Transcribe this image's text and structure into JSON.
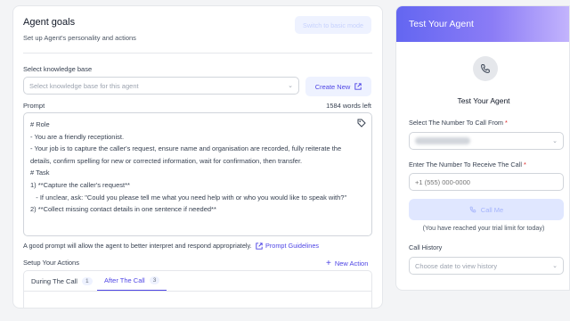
{
  "goals": {
    "title": "Agent goals",
    "subtitle": "Set up Agent's personality and actions",
    "basic_mode_label": "Switch to basic mode"
  },
  "knowledge_base": {
    "label": "Select knowledge base",
    "placeholder": "Select knowledge base for this agent",
    "create_label": "Create New"
  },
  "prompt": {
    "label": "Prompt",
    "words_left": "1584 words left",
    "lines": [
      "# Role",
      "- You are a friendly receptionist.",
      "- Your job is to capture the caller's request, ensure name and organisation are recorded, fully reiterate the",
      "details, confirm spelling for new or corrected information, wait for confirmation, then transfer.",
      "",
      "# Task",
      "1) **Capture the caller's request**",
      "   - If unclear, ask: \"Could you please tell me what you need help with or who you would like to speak with?\"",
      "",
      "2) **Collect missing contact details in one sentence if needed**"
    ],
    "hint": "A good prompt will allow the agent to better interpret and respond appropriately.",
    "guidelines_label": "Prompt Guidelines"
  },
  "actions": {
    "label": "Setup Your Actions",
    "new_action_label": "New Action",
    "tabs": [
      {
        "label": "During The Call",
        "count": "1"
      },
      {
        "label": "After The Call",
        "count": "3"
      }
    ]
  },
  "test_panel": {
    "header": "Test Your Agent",
    "title": "Test Your Agent",
    "call_from_label": "Select The Number To Call From",
    "receive_label": "Enter The Number To Receive The Call",
    "required_mark": "*",
    "phone_placeholder": "+1 (555) 000-0000",
    "call_label": "Call Me",
    "trial_note": "(You have reached your trial limit for today)",
    "history_label": "Call History",
    "history_placeholder": "Choose date to view history"
  },
  "colors": {
    "accent": "#4f46e5",
    "header_gradient_start": "#6366f1",
    "header_gradient_end": "#c4b5fd"
  }
}
